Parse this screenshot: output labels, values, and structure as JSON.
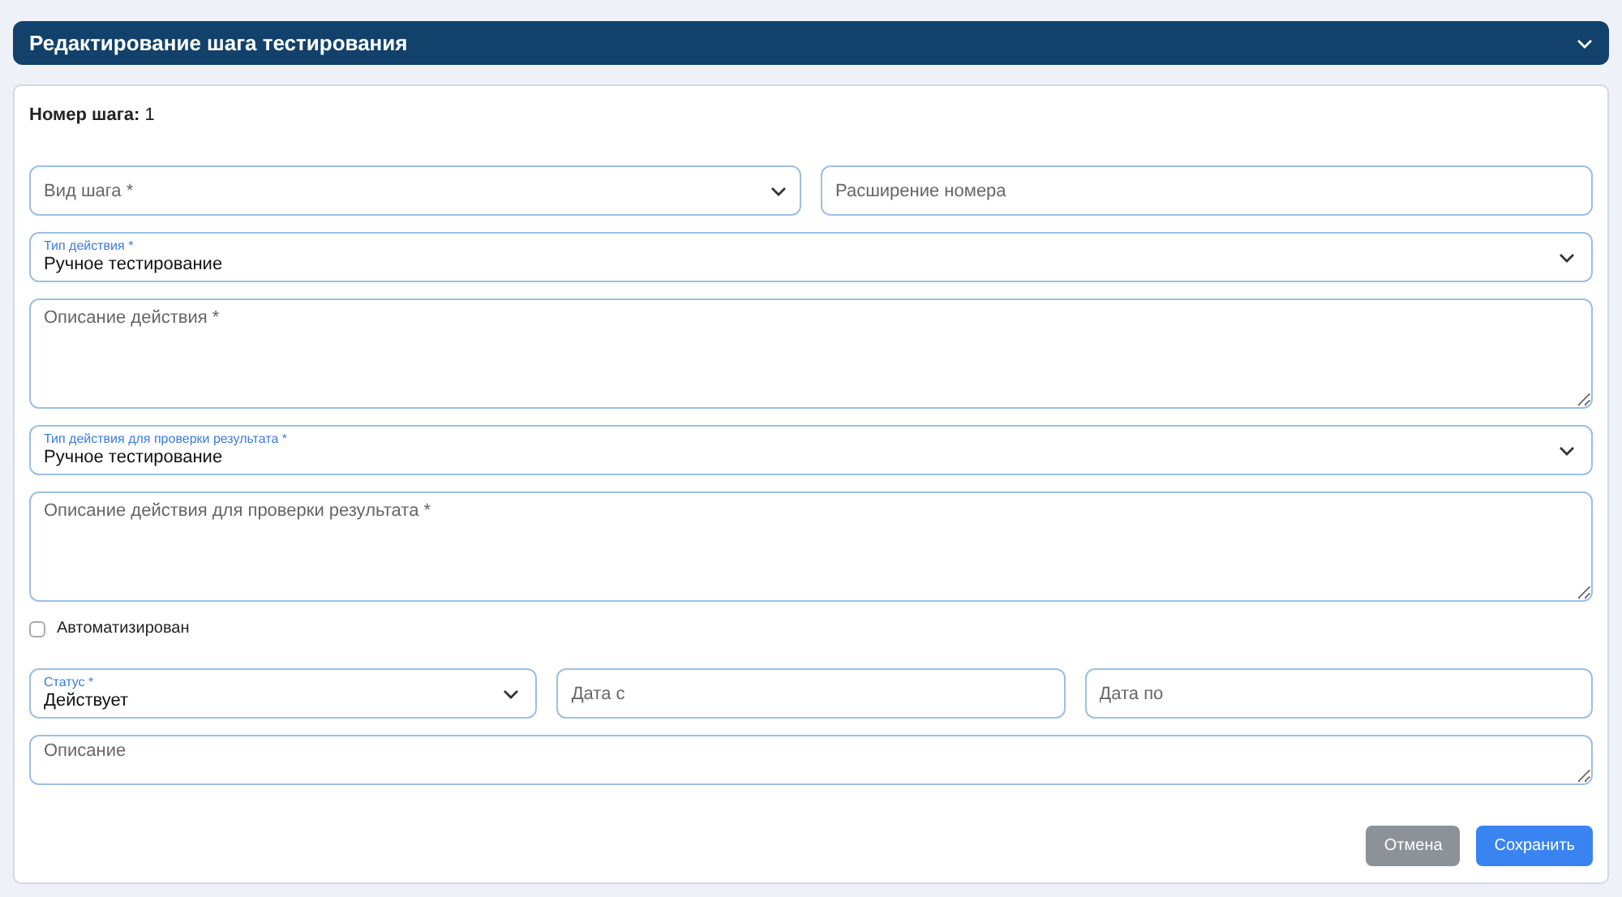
{
  "header": {
    "title": "Редактирование шага тестирования",
    "expanded": true
  },
  "step_number": {
    "label": "Номер шага:",
    "value": "1"
  },
  "rows": [
    [
      {
        "kind": "select",
        "placeholder": "Вид шага *"
      },
      {
        "kind": "input",
        "placeholder": "Расширение номера"
      }
    ],
    [
      {
        "kind": "select",
        "label": "Тип действия *",
        "value": "Ручное тестирование"
      }
    ],
    [
      {
        "kind": "textarea",
        "placeholder": "Описание действия *"
      }
    ],
    [
      {
        "kind": "select",
        "label": "Тип действия для проверки результата *",
        "value": "Ручное тестирование"
      }
    ],
    [
      {
        "kind": "textarea",
        "placeholder": "Описание действия для проверки результата *"
      }
    ],
    [
      {
        "kind": "checkbox",
        "label": "Автоматизирован",
        "checked": false
      }
    ],
    [
      {
        "kind": "select",
        "label": "Статус *",
        "value": "Действует"
      },
      {
        "kind": "input",
        "placeholder": "Дата с"
      },
      {
        "kind": "input",
        "placeholder": "Дата по"
      }
    ],
    [
      {
        "kind": "textarea_short",
        "placeholder": "Описание"
      }
    ]
  ],
  "buttons": [
    {
      "label": "Отмена",
      "kind": "secondary"
    },
    {
      "label": "Сохранить",
      "kind": "primary"
    }
  ]
}
